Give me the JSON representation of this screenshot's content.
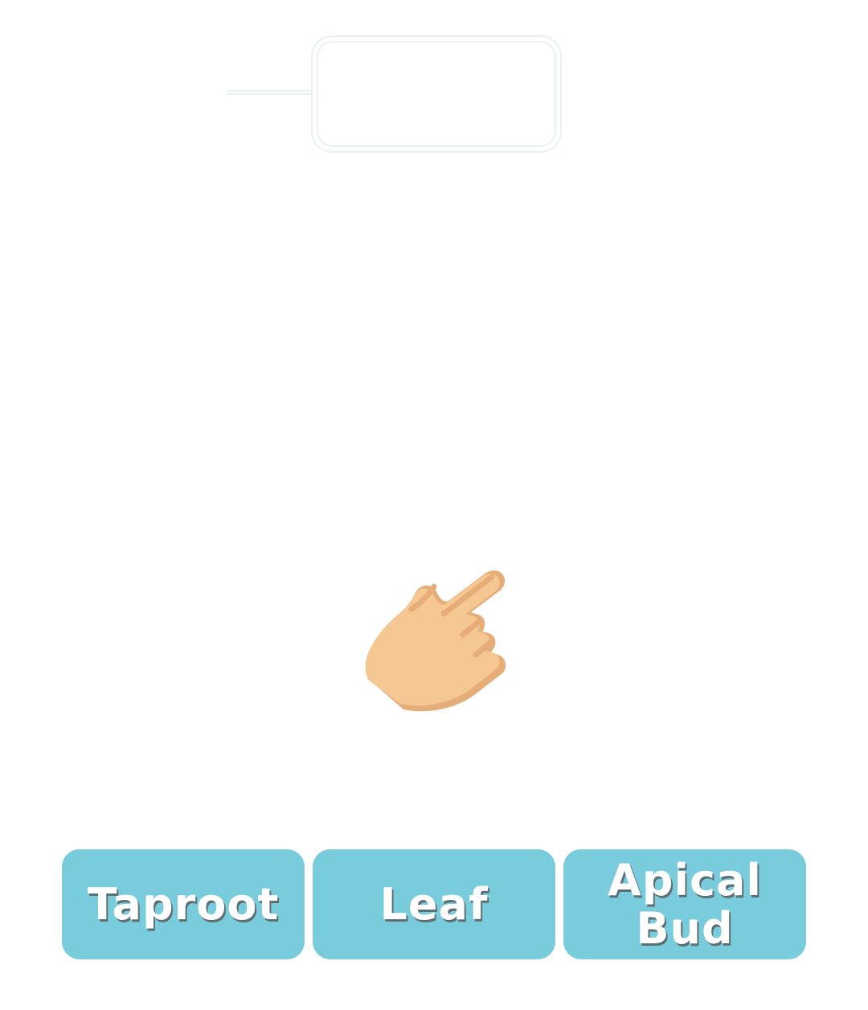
{
  "drop_zone": {
    "answer": ""
  },
  "hint": {
    "icon": "pointing-hand-icon"
  },
  "options": [
    {
      "label": "Taproot"
    },
    {
      "label": "Leaf"
    },
    {
      "label": "Apical\nBud"
    }
  ],
  "colors": {
    "option_background": "#79ccdc",
    "option_text": "#ffffff",
    "drop_zone_border": "#e6f2f4",
    "skin": "#f5c792",
    "skin_shadow": "#e6ad78"
  }
}
